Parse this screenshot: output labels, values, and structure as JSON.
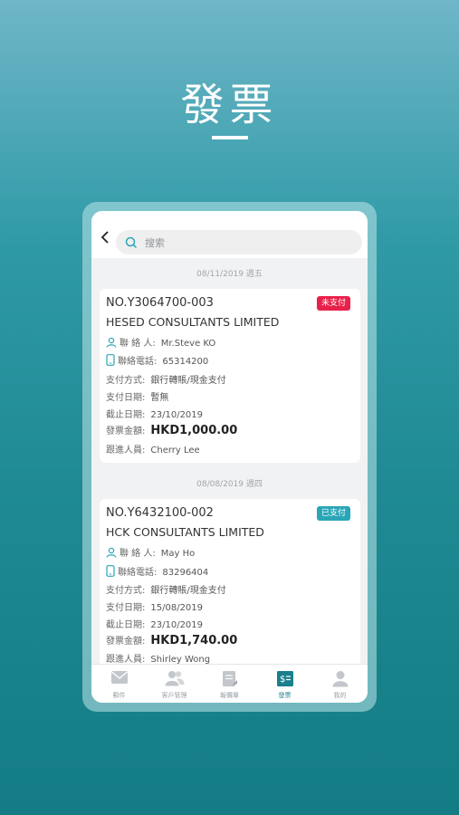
{
  "headline": "發票",
  "search": {
    "placeholder": "搜索"
  },
  "groups": [
    {
      "date": "08/11/2019 週五",
      "invoice": {
        "number": "NO.Y3064700-003",
        "company": "HESED CONSULTANTS LIMITED",
        "status": "未支付",
        "status_color": "#e8214a",
        "contact_label": "聯 絡 人:",
        "contact": "Mr.Steve KO",
        "phone_label": "聯絡電話:",
        "phone": "65314200",
        "payment_method_label": "支付方式:",
        "payment_method": "銀行轉賬/現金支付",
        "payment_date_label": "支付日期:",
        "payment_date": "暫無",
        "due_date_label": "截止日期:",
        "due_date": "23/10/2019",
        "amount_label": "發票金額:",
        "amount": "HKD1,000.00",
        "follow_label": "跟進人員:",
        "follow": "Cherry Lee"
      }
    },
    {
      "date": "08/08/2019 週四",
      "invoice": {
        "number": "NO.Y6432100-002",
        "company": "HCK CONSULTANTS LIMITED",
        "status": "已支付",
        "status_color": "#2aa6b7",
        "contact_label": "聯 絡 人:",
        "contact": "May Ho",
        "phone_label": "聯絡電話:",
        "phone": "83296404",
        "payment_method_label": "支付方式:",
        "payment_method": "銀行轉賬/現金支付",
        "payment_date_label": "支付日期:",
        "payment_date": "15/08/2019",
        "due_date_label": "截止日期:",
        "due_date": "23/10/2019",
        "amount_label": "發票金額:",
        "amount": "HKD1,740.00",
        "follow_label": "跟進人員:",
        "follow": "Shirley Wong"
      }
    }
  ],
  "bottom_nav": [
    {
      "label": "郵件",
      "icon": "mail-icon"
    },
    {
      "label": "客戶管理",
      "icon": "clients-icon"
    },
    {
      "label": "報價單",
      "icon": "quotation-icon"
    },
    {
      "label": "發票",
      "icon": "invoice-icon",
      "active": true
    },
    {
      "label": "我的",
      "icon": "profile-icon"
    }
  ],
  "colors": {
    "accent": "#1a7f8c",
    "unpaid": "#e8214a",
    "paid": "#2aa6b7"
  }
}
